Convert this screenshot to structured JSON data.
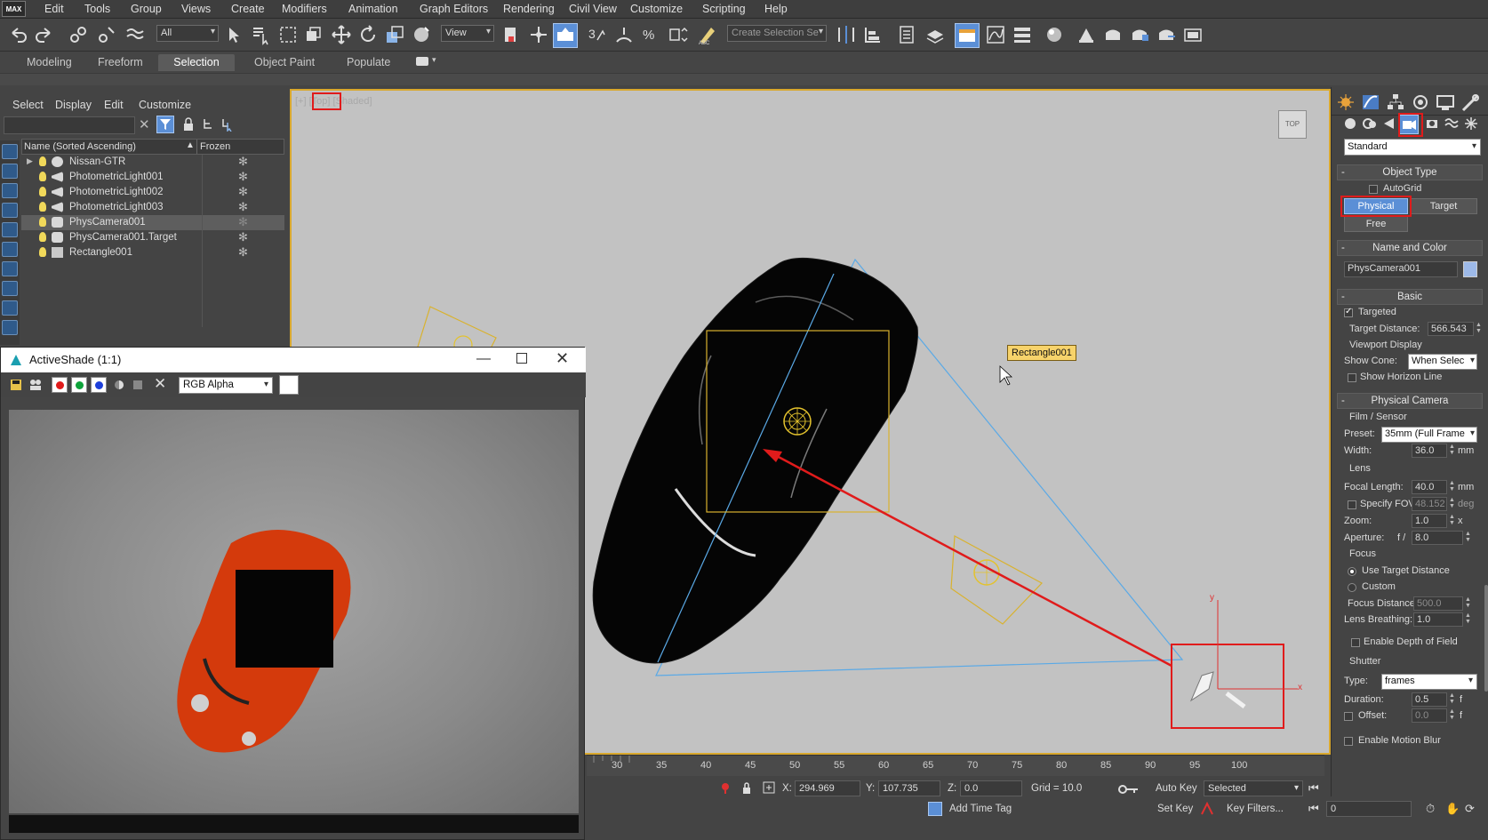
{
  "menubar": {
    "logo": "MAX",
    "items": [
      "Edit",
      "Tools",
      "Group",
      "Views",
      "Create",
      "Modifiers",
      "Animation",
      "Graph Editors",
      "Rendering",
      "Civil View",
      "Customize",
      "Scripting",
      "Help"
    ]
  },
  "toolbar": {
    "selection_filter": "All",
    "ref_coord": "View",
    "selection_set_placeholder": "Create Selection Se"
  },
  "ribbon": {
    "tabs": [
      "Modeling",
      "Freeform",
      "Selection",
      "Object Paint",
      "Populate"
    ],
    "active_tab": "Selection"
  },
  "explorer": {
    "menus": [
      "Select",
      "Display",
      "Edit",
      "Customize"
    ],
    "col_name": "Name (Sorted Ascending)",
    "col_frozen": "Frozen",
    "rows": [
      {
        "label": "Nissan-GTR",
        "type": "geometry"
      },
      {
        "label": "PhotometricLight001",
        "type": "light"
      },
      {
        "label": "PhotometricLight002",
        "type": "light"
      },
      {
        "label": "PhotometricLight003",
        "type": "light"
      },
      {
        "label": "PhysCamera001",
        "type": "camera",
        "selected": true
      },
      {
        "label": "PhysCamera001.Target",
        "type": "camera"
      },
      {
        "label": "Rectangle001",
        "type": "shape"
      }
    ]
  },
  "viewport": {
    "label_plus": "[+]",
    "label_view": "[Top]",
    "label_shading": "[Shaded]",
    "viewcube": "TOP",
    "tooltip": "Rectangle001",
    "axis_x": "x",
    "axis_y": "y"
  },
  "activeshade": {
    "title": "ActiveShade (1:1)",
    "channel": "RGB Alpha"
  },
  "timeline": {
    "ticks": [
      "30",
      "35",
      "40",
      "45",
      "50",
      "55",
      "60",
      "65",
      "70",
      "75",
      "80",
      "85",
      "90",
      "95",
      "100"
    ]
  },
  "status": {
    "x_label": "X:",
    "x_value": "294.969",
    "y_label": "Y:",
    "y_value": "107.735",
    "z_label": "Z:",
    "z_value": "0.0",
    "grid": "Grid = 10.0",
    "auto_key": "Auto Key",
    "key_mode": "Selected",
    "set_key": "Set Key",
    "key_filters": "Key Filters...",
    "add_time_tag": "Add Time Tag",
    "frame": "0"
  },
  "command_panel": {
    "category": "Standard",
    "object_type": {
      "title": "Object Type",
      "autogrid": "AutoGrid",
      "buttons": [
        "Physical",
        "Target",
        "Free"
      ]
    },
    "name_color": {
      "title": "Name and Color",
      "name": "PhysCamera001",
      "color": "#9db9e8"
    },
    "basic": {
      "title": "Basic",
      "targeted": "Targeted",
      "target_distance_label": "Target Distance:",
      "target_distance": "566.543",
      "viewport_display": "Viewport Display",
      "show_cone_label": "Show Cone:",
      "show_cone": "When Selec",
      "horizon": "Show Horizon Line"
    },
    "physical_camera": {
      "title": "Physical Camera",
      "film_sensor": "Film / Sensor",
      "preset_label": "Preset:",
      "preset": "35mm (Full Frame",
      "width_label": "Width:",
      "width": "36.0",
      "width_unit": "mm",
      "lens": "Lens",
      "focal_label": "Focal Length:",
      "focal": "40.0",
      "focal_unit": "mm",
      "fov_label": "Specify FOV:",
      "fov": "48.152",
      "fov_unit": "deg",
      "zoom_label": "Zoom:",
      "zoom": "1.0",
      "zoom_unit": "x",
      "aperture_label": "Aperture:",
      "aperture_f": "f /",
      "aperture": "8.0",
      "focus": "Focus",
      "use_target": "Use Target Distance",
      "custom": "Custom",
      "focus_distance_label": "Focus Distance:",
      "focus_distance": "500.0",
      "lens_breathing_label": "Lens Breathing:",
      "lens_breathing": "1.0",
      "dof": "Enable Depth of Field",
      "shutter": "Shutter",
      "type_label": "Type:",
      "type": "frames",
      "duration_label": "Duration:",
      "duration": "0.5",
      "duration_unit": "f",
      "offset_label": "Offset:",
      "offset": "0.0",
      "offset_unit": "f",
      "motion_blur": "Enable Motion Blur"
    }
  },
  "colors": {
    "highlight_red": "#e01b1b",
    "selection_yellow": "#d9a82d",
    "active_blue": "#5b8fd6",
    "cone_blue": "#5aa9e6"
  }
}
